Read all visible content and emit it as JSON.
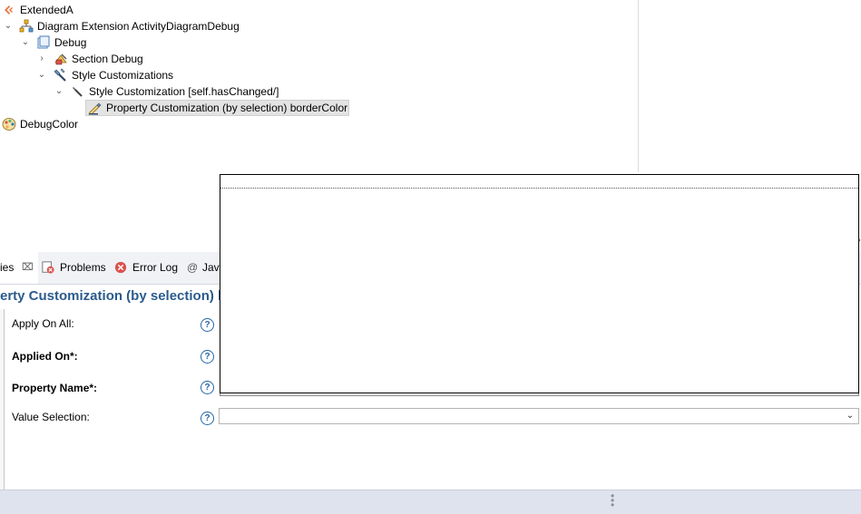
{
  "tree": {
    "items": [
      {
        "label": "ExtendedA",
        "icon": "extension-icon"
      },
      {
        "label": "Diagram Extension ActivityDiagramDebug",
        "icon": "diagram-extension-icon"
      },
      {
        "label": "Debug",
        "icon": "layer-icon"
      },
      {
        "label": "Section Debug",
        "icon": "section-icon"
      },
      {
        "label": "Style Customizations",
        "icon": "style-customizations-icon"
      },
      {
        "label": "Style Customization [self.hasChanged/]",
        "icon": "style-customization-icon"
      },
      {
        "label": "Property Customization (by selection) borderColor",
        "icon": "property-customization-icon"
      },
      {
        "label": "DebugColor",
        "icon": "palette-icon"
      }
    ]
  },
  "tabs": [
    {
      "label": "ies",
      "active": true
    },
    {
      "label": "Problems"
    },
    {
      "label": "Error Log"
    },
    {
      "label": "Java"
    }
  ],
  "properties": {
    "title": "erty Customization (by selection) b",
    "fields": [
      {
        "label": "Apply On All:",
        "bold": false
      },
      {
        "label": "Applied On*:",
        "bold": true
      },
      {
        "label": "Property Name*:",
        "bold": true
      },
      {
        "label": "Value Selection:",
        "bold": false
      }
    ],
    "help_glyph": "?",
    "value_selection": ""
  },
  "colors": {
    "title": "#2b5b8c",
    "help": "#2466a8",
    "statusbar": "#dfe3ee",
    "selection": "#e3e3e3"
  }
}
